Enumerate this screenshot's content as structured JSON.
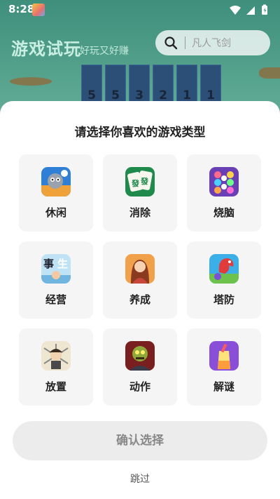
{
  "status_bar": {
    "time": "8:28"
  },
  "header": {
    "title": "游戏试玩",
    "subtitle": "好玩又好赚",
    "search_placeholder": "凡人飞剑"
  },
  "background_tiles": [
    "5",
    "5",
    "3",
    "2",
    "1",
    "1"
  ],
  "sheet": {
    "title": "请选择你喜欢的游戏类型",
    "categories": [
      {
        "label": "休闲",
        "icon": "leisure-game-icon"
      },
      {
        "label": "消除",
        "icon": "mahjong-icon"
      },
      {
        "label": "烧脑",
        "icon": "puzzle-balls-icon"
      },
      {
        "label": "经营",
        "icon": "business-game-icon"
      },
      {
        "label": "养成",
        "icon": "character-raising-icon"
      },
      {
        "label": "塔防",
        "icon": "dragon-tower-defense-icon"
      },
      {
        "label": "放置",
        "icon": "idle-warrior-icon"
      },
      {
        "label": "动作",
        "icon": "zombie-action-icon"
      },
      {
        "label": "解谜",
        "icon": "liquid-puzzle-icon"
      }
    ],
    "confirm_label": "确认选择",
    "skip_label": "跳过"
  },
  "colors": {
    "sheet_bg": "#ffffff",
    "card_bg": "#f5f5f5",
    "confirm_bg": "#ececec",
    "page_bg": "#4a9a86"
  }
}
